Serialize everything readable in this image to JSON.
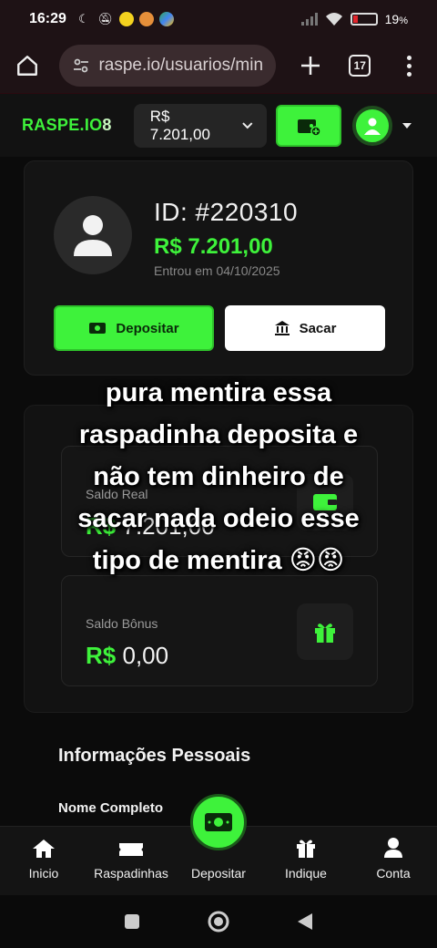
{
  "status_bar": {
    "time": "16:29",
    "battery_text": "19",
    "battery_suffix": "%",
    "battery_level": 0.19
  },
  "browser": {
    "url": "raspe.io/usuarios/min",
    "tab_count": "17"
  },
  "header": {
    "logo": "RASPE.IO",
    "logo_suffix": "8",
    "balance": "R$ 7.201,00"
  },
  "profile": {
    "id": "ID: #220310",
    "balance": "R$ 7.201,00",
    "joined": "Entrou em 04/10/2025",
    "deposit_label": "Depositar",
    "withdraw_label": "Sacar"
  },
  "wallet": {
    "real_label": "Saldo Real",
    "real_currency": "R$",
    "real_value": "7.201,00",
    "bonus_label": "Saldo Bônus",
    "bonus_currency": "R$",
    "bonus_value": "0,00"
  },
  "personal": {
    "title": "Informações Pessoais",
    "name_label": "Nome Completo"
  },
  "overlay_caption": [
    "pura mentira essa",
    "raspadinha deposita e",
    "não tem dinheiro de",
    "sacar nada odeio esse",
    "tipo de mentira 😡😡"
  ],
  "bottom_nav": [
    {
      "label": "Inicio",
      "icon": "home-icon"
    },
    {
      "label": "Raspadinhas",
      "icon": "ticket-icon"
    },
    {
      "label": "Depositar",
      "icon": "cash-icon"
    },
    {
      "label": "Indique",
      "icon": "gift-icon"
    },
    {
      "label": "Conta",
      "icon": "user-icon"
    }
  ],
  "colors": {
    "accent": "#3ef23b",
    "background": "#0b0b0b",
    "card": "#141414"
  }
}
